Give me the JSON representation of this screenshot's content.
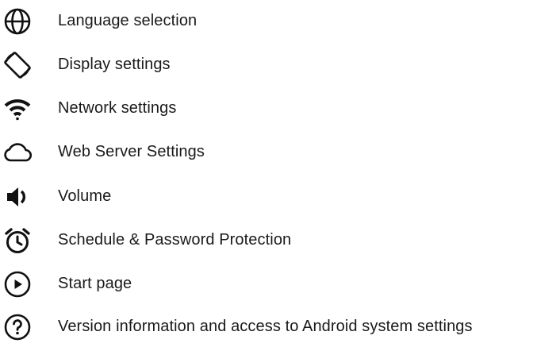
{
  "colors": {
    "text": "#1a1a1a",
    "icon": "#111111",
    "background": "#ffffff"
  },
  "menu": {
    "items": [
      {
        "label": "Language selection",
        "icon": "globe-icon"
      },
      {
        "label": "Display settings",
        "icon": "screen-rotation-icon"
      },
      {
        "label": "Network settings",
        "icon": "wifi-icon"
      },
      {
        "label": "Web Server Settings",
        "icon": "cloud-icon"
      },
      {
        "label": "Volume",
        "icon": "speaker-icon"
      },
      {
        "label": "Schedule & Password Protection",
        "icon": "alarm-clock-icon"
      },
      {
        "label": "Start page",
        "icon": "play-circle-icon"
      },
      {
        "label": "Version information and access to Android system settings",
        "icon": "help-circle-icon"
      }
    ]
  }
}
